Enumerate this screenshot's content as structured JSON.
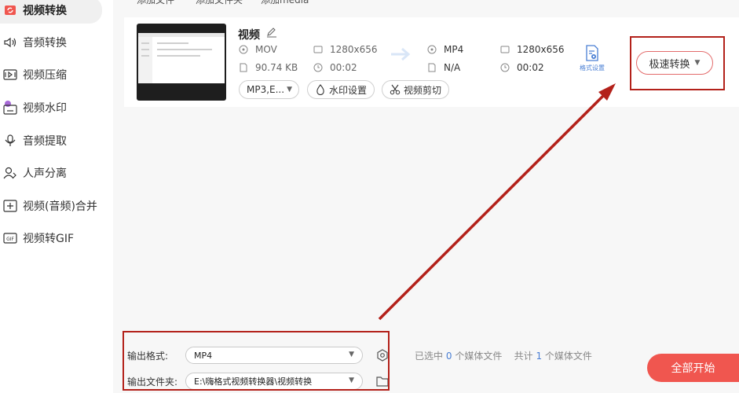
{
  "sidebar": {
    "items": [
      {
        "label": "视频转换",
        "icon": "video-convert-icon"
      },
      {
        "label": "音频转换",
        "icon": "audio-convert-icon"
      },
      {
        "label": "视频压缩",
        "icon": "video-compress-icon"
      },
      {
        "label": "视频水印",
        "icon": "video-watermark-icon"
      },
      {
        "label": "音频提取",
        "icon": "audio-extract-icon"
      },
      {
        "label": "人声分离",
        "icon": "vocal-separate-icon"
      },
      {
        "label": "视频(音频)合并",
        "icon": "merge-icon"
      },
      {
        "label": "视频转GIF",
        "icon": "gif-icon"
      }
    ]
  },
  "topbar": {
    "add_file": "添加文件",
    "add_folder": "添加文件夹",
    "add_media": "添加media"
  },
  "file": {
    "name": "视频",
    "src_format": "MOV",
    "src_resolution": "1280x656",
    "src_size": "90.74 KB",
    "src_duration": "00:02",
    "dst_format": "MP4",
    "dst_resolution": "1280x656",
    "dst_size": "N/A",
    "dst_duration": "00:02",
    "audio_track": "MP3,E...",
    "watermark_label": "水印设置",
    "cut_label": "视频剪切",
    "format_settings_label": "格式设置",
    "fast_convert_label": "极速转换"
  },
  "output": {
    "format_label": "输出格式:",
    "format_value": "MP4",
    "folder_label": "输出文件夹:",
    "folder_value": "E:\\嗨格式视频转换器\\视频转换"
  },
  "stats": {
    "selected_prefix": "已选中",
    "selected_count": "0",
    "selected_suffix": "个媒体文件",
    "total_prefix": "共计",
    "total_count": "1",
    "total_suffix": "个媒体文件"
  },
  "start_all_label": "全部开始",
  "colors": {
    "accent_red": "#f0564f",
    "annotation_red": "#b3211a",
    "link_blue": "#4a7fd4"
  }
}
